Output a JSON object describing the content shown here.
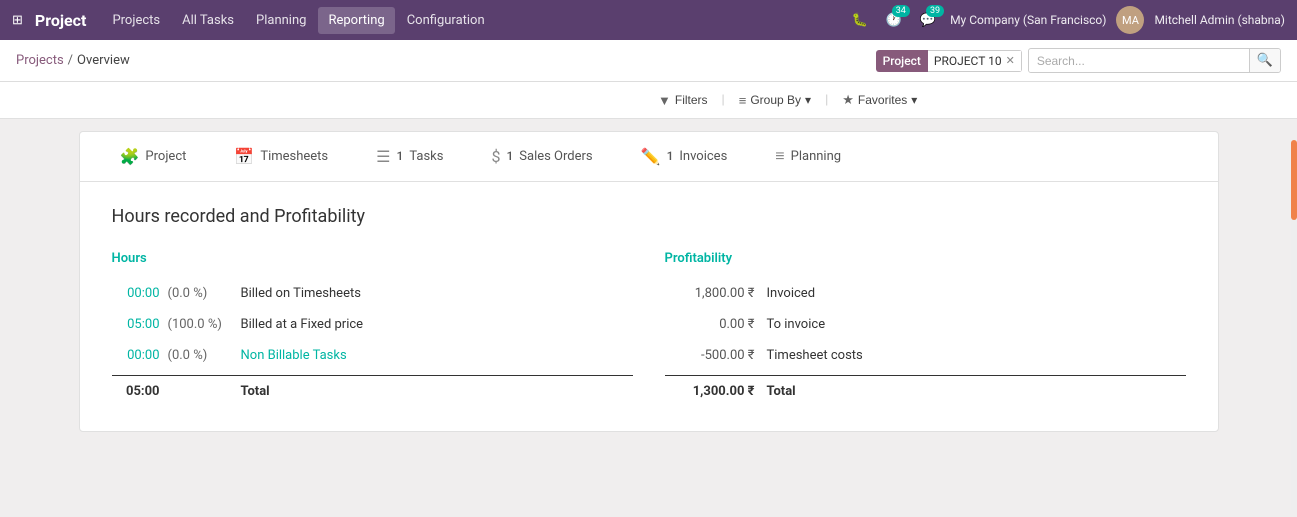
{
  "app": {
    "title": "Project",
    "grid_icon": "⊞"
  },
  "navbar": {
    "links": [
      {
        "label": "Projects",
        "active": false
      },
      {
        "label": "All Tasks",
        "active": false
      },
      {
        "label": "Planning",
        "active": false
      },
      {
        "label": "Reporting",
        "active": true
      },
      {
        "label": "Configuration",
        "active": false
      }
    ],
    "icon_bug": "🐛",
    "badge_clock": "34",
    "badge_chat": "39",
    "company": "My Company (San Francisco)",
    "user_name": "Mitchell Admin (shabna)",
    "user_initials": "MA"
  },
  "breadcrumb": {
    "link": "Projects",
    "separator": "/",
    "current": "Overview"
  },
  "filter": {
    "tag_label": "Project",
    "tag_value": "PROJECT 10",
    "search_placeholder": "Search...",
    "filters_label": "Filters",
    "group_by_label": "Group By",
    "favorites_label": "Favorites"
  },
  "card": {
    "tabs": [
      {
        "icon": "🧩",
        "label": "Project",
        "count": ""
      },
      {
        "icon": "📅",
        "label": "Timesheets",
        "count": ""
      },
      {
        "icon": "☰",
        "label": "Tasks",
        "count": "1"
      },
      {
        "icon": "$",
        "label": "Sales Orders",
        "count": "1"
      },
      {
        "icon": "✏️",
        "label": "Invoices",
        "count": "1"
      },
      {
        "icon": "≡",
        "label": "Planning",
        "count": ""
      }
    ],
    "section_title": "Hours recorded and Profitability",
    "hours_title": "Hours",
    "profitability_title": "Profitability",
    "hours_rows": [
      {
        "val": "00:00",
        "pct": "(0.0 %)",
        "label": "Billed on Timesheets",
        "link": false
      },
      {
        "val": "05:00",
        "pct": "(100.0 %)",
        "label": "Billed at a Fixed price",
        "link": false
      },
      {
        "val": "00:00",
        "pct": "(0.0 %)",
        "label": "Non Billable Tasks",
        "link": true
      }
    ],
    "hours_total": {
      "val": "05:00",
      "label": "Total"
    },
    "profit_rows": [
      {
        "val": "1,800.00 ₹",
        "label": "Invoiced"
      },
      {
        "val": "0.00 ₹",
        "label": "To invoice"
      },
      {
        "val": "-500.00 ₹",
        "label": "Timesheet costs"
      }
    ],
    "profit_total": {
      "val": "1,300.00 ₹",
      "label": "Total"
    }
  }
}
